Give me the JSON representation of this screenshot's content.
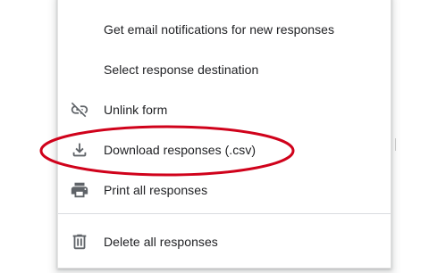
{
  "menu": {
    "items": [
      {
        "label": "Get email notifications for new responses",
        "icon": null
      },
      {
        "label": "Select response destination",
        "icon": null
      },
      {
        "label": "Unlink form",
        "icon": "unlink-icon"
      },
      {
        "label": "Download responses (.csv)",
        "icon": "download-icon"
      },
      {
        "label": "Print all responses",
        "icon": "print-icon"
      },
      {
        "label": "Delete all responses",
        "icon": "trash-icon"
      }
    ]
  },
  "annotation": {
    "color": "#d0021b",
    "shape": "ellipse",
    "target": "Download responses (.csv)"
  },
  "colors": {
    "text": "#202124",
    "icon": "#5f6368",
    "divider": "#dadce0"
  }
}
